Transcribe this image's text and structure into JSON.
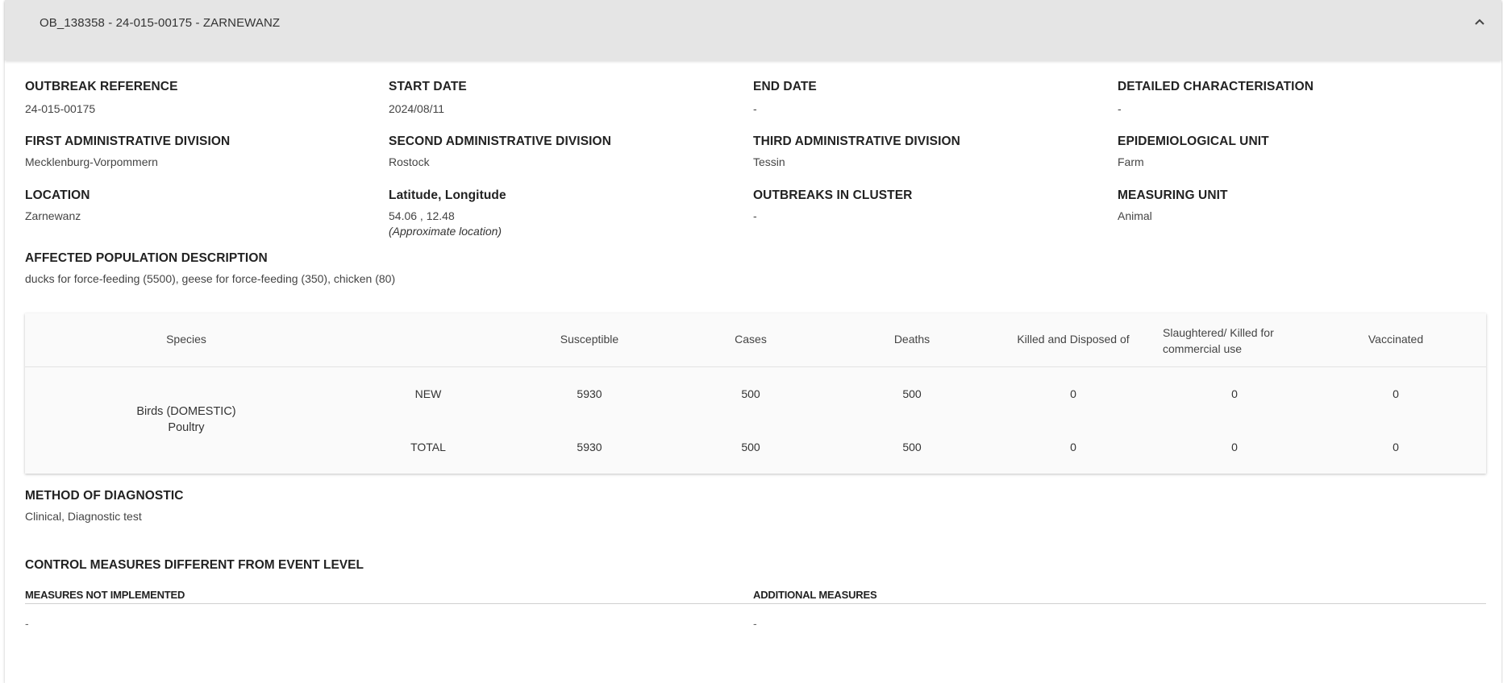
{
  "panel": {
    "title": "OB_138358 - 24-015-00175 - ZARNEWANZ",
    "collapse_icon": "chevron-up-icon"
  },
  "fields": {
    "outbreak_reference": {
      "label": "OUTBREAK REFERENCE",
      "value": "24-015-00175"
    },
    "start_date": {
      "label": "START DATE",
      "value": "2024/08/11"
    },
    "end_date": {
      "label": "END DATE",
      "value": "-"
    },
    "detailed_characterisation": {
      "label": "DETAILED CHARACTERISATION",
      "value": "-"
    },
    "first_admin_division": {
      "label": "FIRST ADMINISTRATIVE DIVISION",
      "value": "Mecklenburg-Vorpommern"
    },
    "second_admin_division": {
      "label": "SECOND ADMINISTRATIVE DIVISION",
      "value": "Rostock"
    },
    "third_admin_division": {
      "label": "THIRD ADMINISTRATIVE DIVISION",
      "value": "Tessin"
    },
    "epidemiological_unit": {
      "label": "EPIDEMIOLOGICAL UNIT",
      "value": "Farm"
    },
    "location": {
      "label": "LOCATION",
      "value": "Zarnewanz"
    },
    "lat_long": {
      "label": "Latitude, Longitude",
      "value": "54.06 , 12.48",
      "note": "(Approximate location)"
    },
    "outbreaks_in_cluster": {
      "label": "OUTBREAKS IN CLUSTER",
      "value": "-"
    },
    "measuring_unit": {
      "label": "MEASURING UNIT",
      "value": "Animal"
    },
    "affected_population": {
      "label": "AFFECTED POPULATION DESCRIPTION",
      "value": "ducks for force-feeding (5500), geese for force-feeding (350), chicken (80)"
    }
  },
  "table": {
    "headers": {
      "species": "Species",
      "susceptible": "Susceptible",
      "cases": "Cases",
      "deaths": "Deaths",
      "killed": "Killed and Disposed of",
      "slaughtered_line1": "Slaughtered/ Killed for",
      "slaughtered_line2": "commercial use",
      "vaccinated": "Vaccinated"
    },
    "species_line1": "Birds (DOMESTIC)",
    "species_line2": "Poultry",
    "rows": [
      {
        "type": "NEW",
        "susceptible": "5930",
        "cases": "500",
        "deaths": "500",
        "killed": "0",
        "slaughtered": "0",
        "vaccinated": "0"
      },
      {
        "type": "TOTAL",
        "susceptible": "5930",
        "cases": "500",
        "deaths": "500",
        "killed": "0",
        "slaughtered": "0",
        "vaccinated": "0"
      }
    ]
  },
  "diagnostic": {
    "label": "METHOD OF DIAGNOSTIC",
    "value": "Clinical, Diagnostic test"
  },
  "control_measures": {
    "title": "CONTROL MEASURES DIFFERENT FROM EVENT LEVEL",
    "not_implemented_label": "MEASURES NOT IMPLEMENTED",
    "not_implemented_value": "-",
    "additional_label": "ADDITIONAL MEASURES",
    "additional_value": "-"
  }
}
